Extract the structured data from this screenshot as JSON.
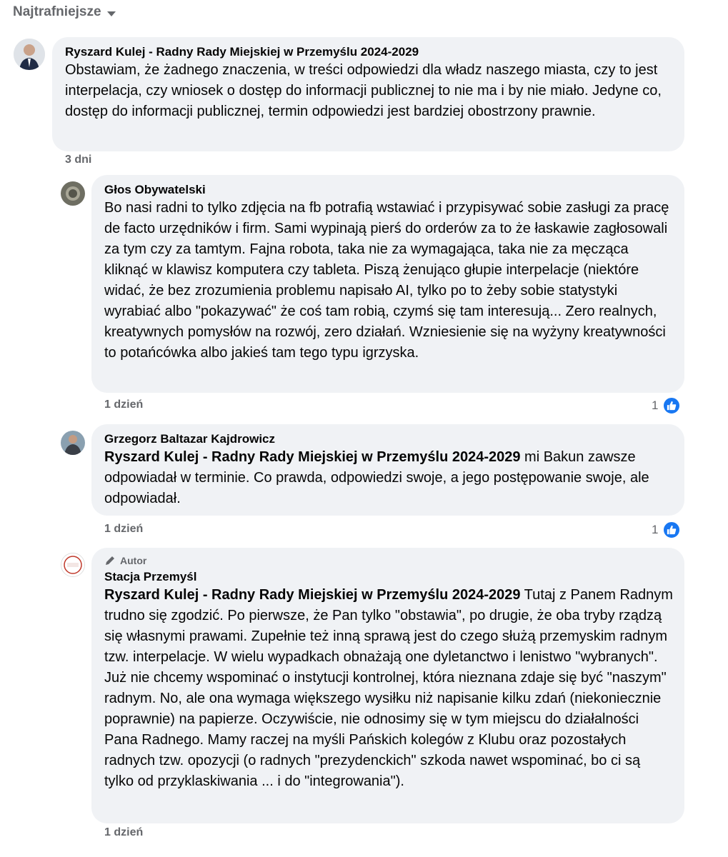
{
  "sort": {
    "label": "Najtrafniejsze"
  },
  "comments": [
    {
      "author": "Ryszard Kulej - Radny Rady Miejskiej w Przemyślu 2024-2029",
      "text": "Obstawiam, że żadnego znaczenia, w treści odpowiedzi dla władz naszego miasta, czy to jest interpelacja, czy wniosek o dostęp do informacji publicznej to nie ma i by nie miało. Jedyne co, dostęp do informacji publicznej, termin odpowiedzi jest bardziej obostrzony prawnie.",
      "time": "3 dni"
    },
    {
      "author": "Głos Obywatelski",
      "text": "Bo nasi radni to tylko zdjęcia na fb potrafią wstawiać i przypisywać sobie zasługi za pracę de facto urzędników i firm. Sami wypinają pierś do orderów za to że łaskawie zagłosowali za tym czy za tamtym. Fajna robota, taka nie za wymagająca, taka nie za męcząca kliknąć w klawisz komputera czy tableta. Piszą żenująco głupie interpelacje (niektóre widać, że bez zrozumienia problemu napisało AI, tylko po to żeby sobie statystyki wyrabiać albo \"pokazywać\" że coś tam robią, czymś się tam interesują... Zero realnych, kreatywnych pomysłów na rozwój, zero działań. Wzniesienie się na wyżyny kreatywności to potańcówka albo jakieś tam tego typu igrzyska.",
      "time": "1 dzień",
      "likes": "1"
    },
    {
      "author": "Grzegorz Baltazar Kajdrowicz",
      "mention": "Ryszard Kulej - Radny Rady Miejskiej w Przemyślu 2024-2029",
      "text": " mi Bakun zawsze odpowiadał w terminie. Co prawda, odpowiedzi swoje, a jego postępowanie swoje, ale odpowiadał.",
      "time": "1 dzień",
      "likes": "1"
    },
    {
      "badge": "Autor",
      "author": "Stacja Przemyśl",
      "mention": "Ryszard Kulej - Radny Rady Miejskiej w Przemyślu 2024-2029",
      "text": " Tutaj z Panem Radnym trudno się zgodzić. Po pierwsze, że Pan tylko \"obstawia\", po drugie, że oba tryby rządzą się własnymi prawami. Zupełnie też inną sprawą jest do czego służą przemyskim radnym tzw. interpelacje. W wielu wypadkach obnażają one dyletanctwo i lenistwo \"wybranych\". Już nie chcemy wspominać o instytucji kontrolnej, która nieznana zdaje się być \"naszym\" radnym. No, ale ona wymaga większego wysiłku niż napisanie kilku zdań (niekoniecznie poprawnie) na papierze. Oczywiście, nie odnosimy się w tym miejscu do działalności Pana Radnego. Mamy raczej na myśli Pańskich kolegów z Klubu oraz pozostałych radnych tzw. opozycji (o radnych \"prezydenckich\" szkoda nawet wspominać, bo ci są tylko od przyklaskiwania ... i do \"integrowania\").",
      "time": "1 dzień"
    }
  ],
  "colors": {
    "bubble": "#f0f2f5",
    "like": "#1877f2",
    "meta": "#65676b"
  },
  "icons": {
    "sort": "chevron-down-icon",
    "like": "thumbs-up-icon",
    "author": "pen-icon"
  }
}
